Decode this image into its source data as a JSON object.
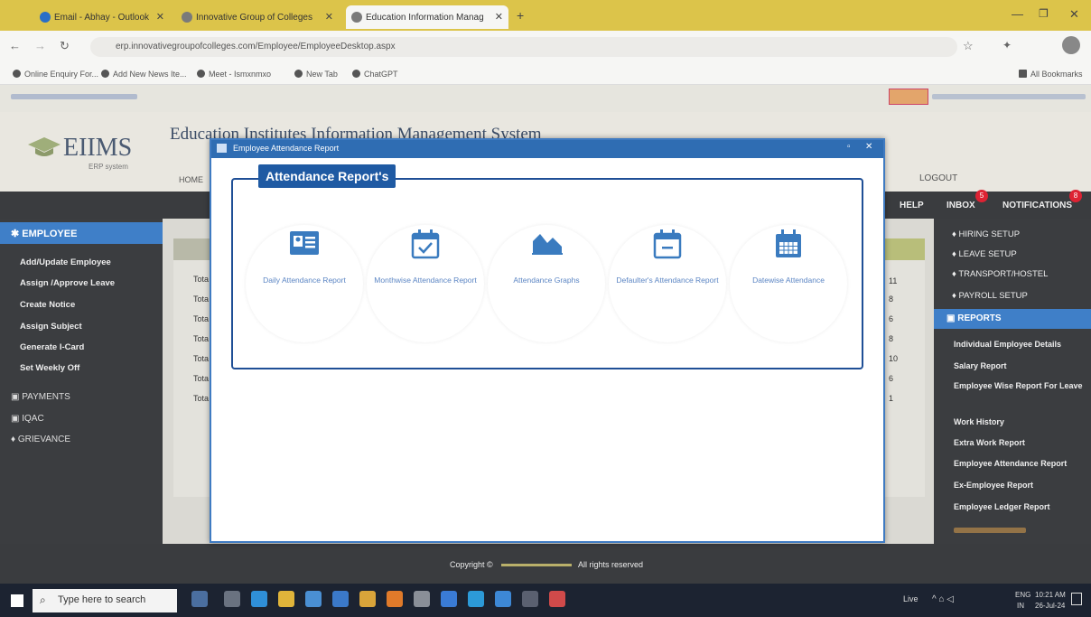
{
  "browser": {
    "tabs": [
      {
        "title": "Email - Abhay - Outlook"
      },
      {
        "title": "Innovative Group of Colleges"
      },
      {
        "title": "Education Information Manag"
      }
    ],
    "url": "erp.innovativegroupofcolleges.com/Employee/EmployeeDesktop.aspx",
    "bookmarks": [
      "Online Enquiry For...",
      "Add New News Ite...",
      "Meet - Ismxnmxo",
      "New Tab",
      "ChatGPT"
    ],
    "all_bookmarks": "All Bookmarks"
  },
  "header": {
    "title": "Education Institutes Information Management System",
    "logo_text": "EIIMS",
    "logo_sub": "ERP system",
    "nav_home": "HOME",
    "nav_logout": "LOGOUT",
    "help": "HELP",
    "inbox": "INBOX",
    "inbox_count": "5",
    "notifications": "NOTIFICATIONS",
    "notifications_count": "8"
  },
  "left_sidebar": {
    "section": "EMPLOYEE",
    "items": [
      "Add/Update Employee",
      "Assign /Approve Leave",
      "Create Notice",
      "Assign Subject",
      "Generate I-Card",
      "Set Weekly Off"
    ],
    "sections": [
      "PAYMENTS",
      "IQAC",
      "GRIEVANCE"
    ]
  },
  "content": {
    "rows": [
      "Tota",
      "Tota",
      "Tota",
      "Tota",
      "Tota",
      "Tota",
      "Tota"
    ],
    "counts": [
      "11",
      "8",
      "6",
      "8",
      "10",
      "6",
      "1"
    ]
  },
  "right_sidebar": {
    "items": [
      "HIRING SETUP",
      "LEAVE SETUP",
      "TRANSPORT/HOSTEL",
      "PAYROLL SETUP"
    ],
    "reports": "REPORTS",
    "report_items": [
      "Individual Employee Details",
      "Salary Report",
      "Employee Wise Report For Leave",
      "Work History",
      "Extra Work Report",
      "Employee Attendance Report",
      "Ex-Employee Report",
      "Employee Ledger Report"
    ]
  },
  "modal": {
    "window_title": "Employee Attendance Report",
    "legend": "Attendance Report's",
    "cards": [
      {
        "label": "Daily Attendance Report"
      },
      {
        "label": "Monthwise Attendance Report"
      },
      {
        "label": "Attendance Graphs"
      },
      {
        "label": "Defaulter's Attendance Report"
      },
      {
        "label": "Datewise Attendance"
      }
    ]
  },
  "footer": {
    "copyright": "Copyright ©",
    "rights": "All rights reserved"
  },
  "taskbar": {
    "search_placeholder": "Type here to search",
    "weather": "Live",
    "lang": "ENG",
    "region": "IN",
    "time": "10:21 AM",
    "date": "26-Jul-24"
  },
  "colors": {
    "accent": "#2f6db3",
    "legend_bg": "#1f5aa3",
    "sidebar_bg": "#3b3d40",
    "tab_bar": "#dcc44a",
    "icon": "#3a7bbf"
  }
}
